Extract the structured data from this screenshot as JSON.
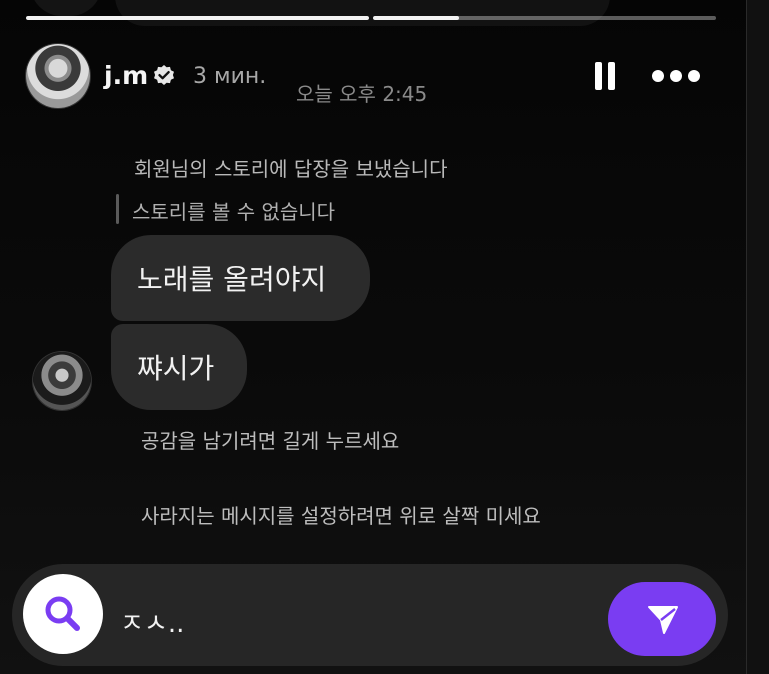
{
  "header": {
    "username": "j.m",
    "verified_icon": "verified-badge-icon",
    "time_ago": "3 мин.",
    "timestamp": "오늘 오후 2:45",
    "pause_icon": "pause-icon",
    "more_icon": "more-horizontal-icon"
  },
  "story_progress": [
    1.0,
    0.25
  ],
  "messages": {
    "reply_note": "회원님의 스토리에 답장을 보냈습니다",
    "quoted_story": "스토리를 볼 수 없습니다",
    "bubbles": [
      {
        "text": "노래를 올려야지"
      },
      {
        "text": "쨔시가"
      }
    ]
  },
  "hints": {
    "like_hint": "공감을 남기려면 길게 누르세요",
    "vanish_hint": "사라지는 메시지를 설정하려면 위로 살짝 미세요"
  },
  "composer": {
    "search_icon": "search-icon",
    "input_value": "ㅈㅅ..",
    "send_icon": "send-icon",
    "accent_color": "#7a3df2"
  }
}
